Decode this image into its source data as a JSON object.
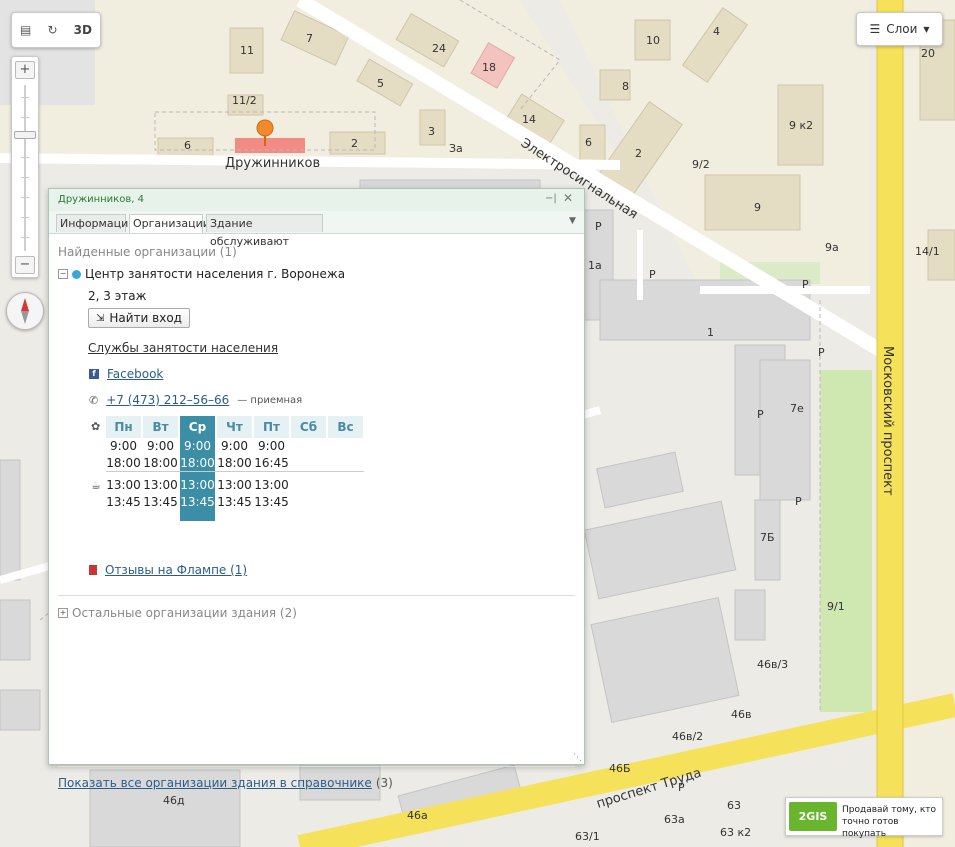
{
  "map": {
    "streets": {
      "druzhinnikov": "Дружинников",
      "elektrosignalnaya": "Электросигнальная",
      "moskovsky": "Московский проспект",
      "truda": "проспект Труда"
    },
    "labels": [
      "7",
      "11",
      "24",
      "18",
      "10",
      "4",
      "20",
      "5",
      "8",
      "11/2",
      "14",
      "3",
      "6",
      "2",
      "За",
      "6",
      "2",
      "9 к2",
      "9/2",
      "9",
      "9а",
      "14/1",
      "Р",
      "Р",
      "1а",
      "Р",
      "1",
      "Р",
      "Р",
      "Р",
      "7е",
      "7Б",
      "Р",
      "9/1",
      "46в/3",
      "46в",
      "46в/2",
      "46Б",
      "46д",
      "46а",
      "63",
      "63а",
      "63 к2",
      "63/1",
      "Р"
    ]
  },
  "toolbar": {
    "tool_3d": "3D"
  },
  "zoom": {
    "plus": "+",
    "minus": "−"
  },
  "layers": {
    "label": "Слои"
  },
  "panel": {
    "title": "Дружинников, 4",
    "tabs": [
      "Информация",
      "Организации",
      "Здание обслуживают"
    ],
    "active_tab": "Организации",
    "found_label": "Найденные организации (1)",
    "org_name": "Центр занятости населения г. Воронежа",
    "floor": "2, 3 этаж",
    "entry_button": "Найти вход",
    "category_link": "Службы занятости населения",
    "facebook": "Facebook",
    "phone": "+7 (473) 212–56–66",
    "phone_note": "— приемная",
    "schedule": {
      "days": [
        "Пн",
        "Вт",
        "Ср",
        "Чт",
        "Пт",
        "Сб",
        "Вс"
      ],
      "today_index": 2,
      "work_from": [
        "9:00",
        "9:00",
        "9:00",
        "9:00",
        "9:00",
        "",
        ""
      ],
      "work_to": [
        "18:00",
        "18:00",
        "18:00",
        "18:00",
        "16:45",
        "",
        ""
      ],
      "lunch_from": [
        "13:00",
        "13:00",
        "13:00",
        "13:00",
        "13:00",
        "",
        ""
      ],
      "lunch_to": [
        "13:45",
        "13:45",
        "13:45",
        "13:45",
        "13:45",
        "",
        ""
      ]
    },
    "flamp_link": "Отзывы на Флампе (1)",
    "others_label": "Остальные организации здания (2)",
    "footer_link": "Показать все организации здания в справочнике",
    "footer_count": "(3)"
  },
  "ad": {
    "logo": "2GIS",
    "line1": "Продавай тому, кто",
    "line2": "точно готов покупать"
  },
  "colors": {
    "road_yellow": "#f6e15a",
    "panel_green": "#2a7a3a",
    "today_blue": "#3b8ea6",
    "park_green": "#cfe8b2"
  }
}
